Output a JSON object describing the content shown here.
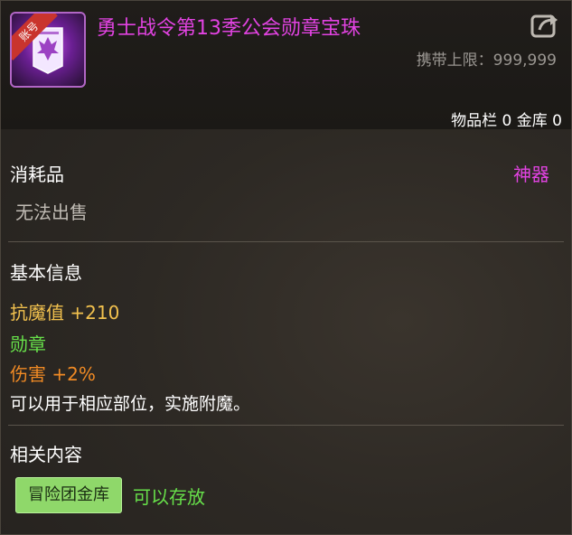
{
  "item": {
    "title": "勇士战令第13季公会勋章宝珠",
    "tag": "账号",
    "carry_limit": "携带上限：999,999",
    "storage": "物品栏 0 金库 0"
  },
  "info": {
    "category": "消耗品",
    "rarity": "神器",
    "sale_status": "无法出售"
  },
  "basic": {
    "heading": "基本信息",
    "stat_label": "抗魔值",
    "stat_value": "+210",
    "type_label": "勋章",
    "dmg_label": "伤害",
    "dmg_value": "+2%",
    "description": "可以用于相应部位，实施附魔。"
  },
  "related": {
    "heading": "相关内容",
    "button_label": "冒险团金库",
    "storable_text": "可以存放"
  },
  "colors": {
    "title": "#e243e2",
    "rarity": "#e243e2",
    "stat": "#f2c14e",
    "type": "#67e04a",
    "damage": "#f08a24"
  },
  "icons": {
    "item_icon": "guild-banner-icon",
    "share": "share-icon"
  }
}
